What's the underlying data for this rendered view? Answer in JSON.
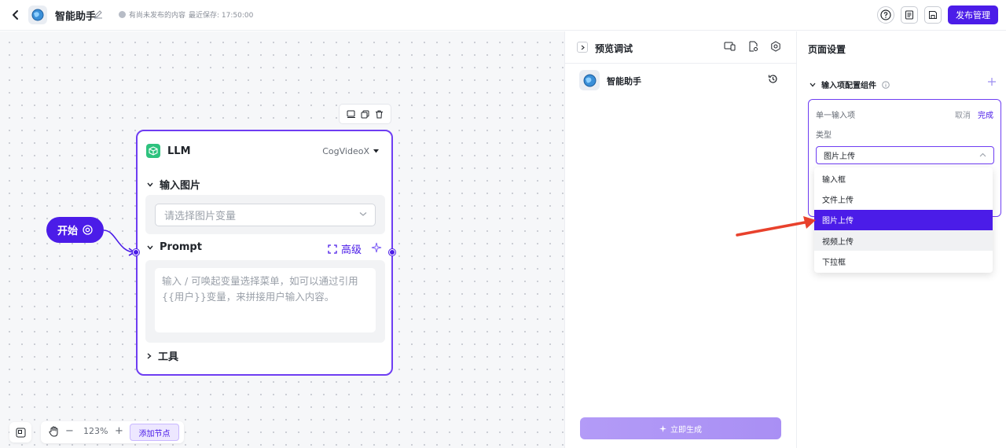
{
  "header": {
    "title": "智能助手",
    "status": "有尚未发布的内容",
    "last_saved": "最近保存: 17:50:00",
    "publish_label": "发布管理"
  },
  "canvas": {
    "start_node_label": "开始",
    "llm_node": {
      "title": "LLM",
      "model": "CogVideoX",
      "image_section": "输入图片",
      "image_placeholder": "请选择图片变量",
      "prompt_section": "Prompt",
      "advanced_label": "高级",
      "prompt_placeholder": "输入 / 可唤起变量选择菜单，如可以通过引用{{用户}}变量，来拼接用户输入内容。",
      "tools_section": "工具"
    },
    "zoom": {
      "level": "123%",
      "minus": "−",
      "plus": "+",
      "add_node_label": "添加节点"
    }
  },
  "preview": {
    "title": "预览调试",
    "app_name": "智能助手",
    "generate_label": "立即生成"
  },
  "settings": {
    "title": "页面设置",
    "section_title": "输入项配置组件",
    "card": {
      "label": "单一输入项",
      "cancel": "取消",
      "done": "完成",
      "type_label": "类型",
      "selected": "图片上传"
    },
    "dropdown_options": [
      "输入框",
      "文件上传",
      "图片上传",
      "视频上传",
      "下拉框"
    ],
    "selected_option_index": 2,
    "hovered_option_index": 3
  },
  "colors": {
    "accent": "#4b1ce8",
    "node_border": "#6e3df2",
    "annotation_arrow": "#e8412c"
  }
}
